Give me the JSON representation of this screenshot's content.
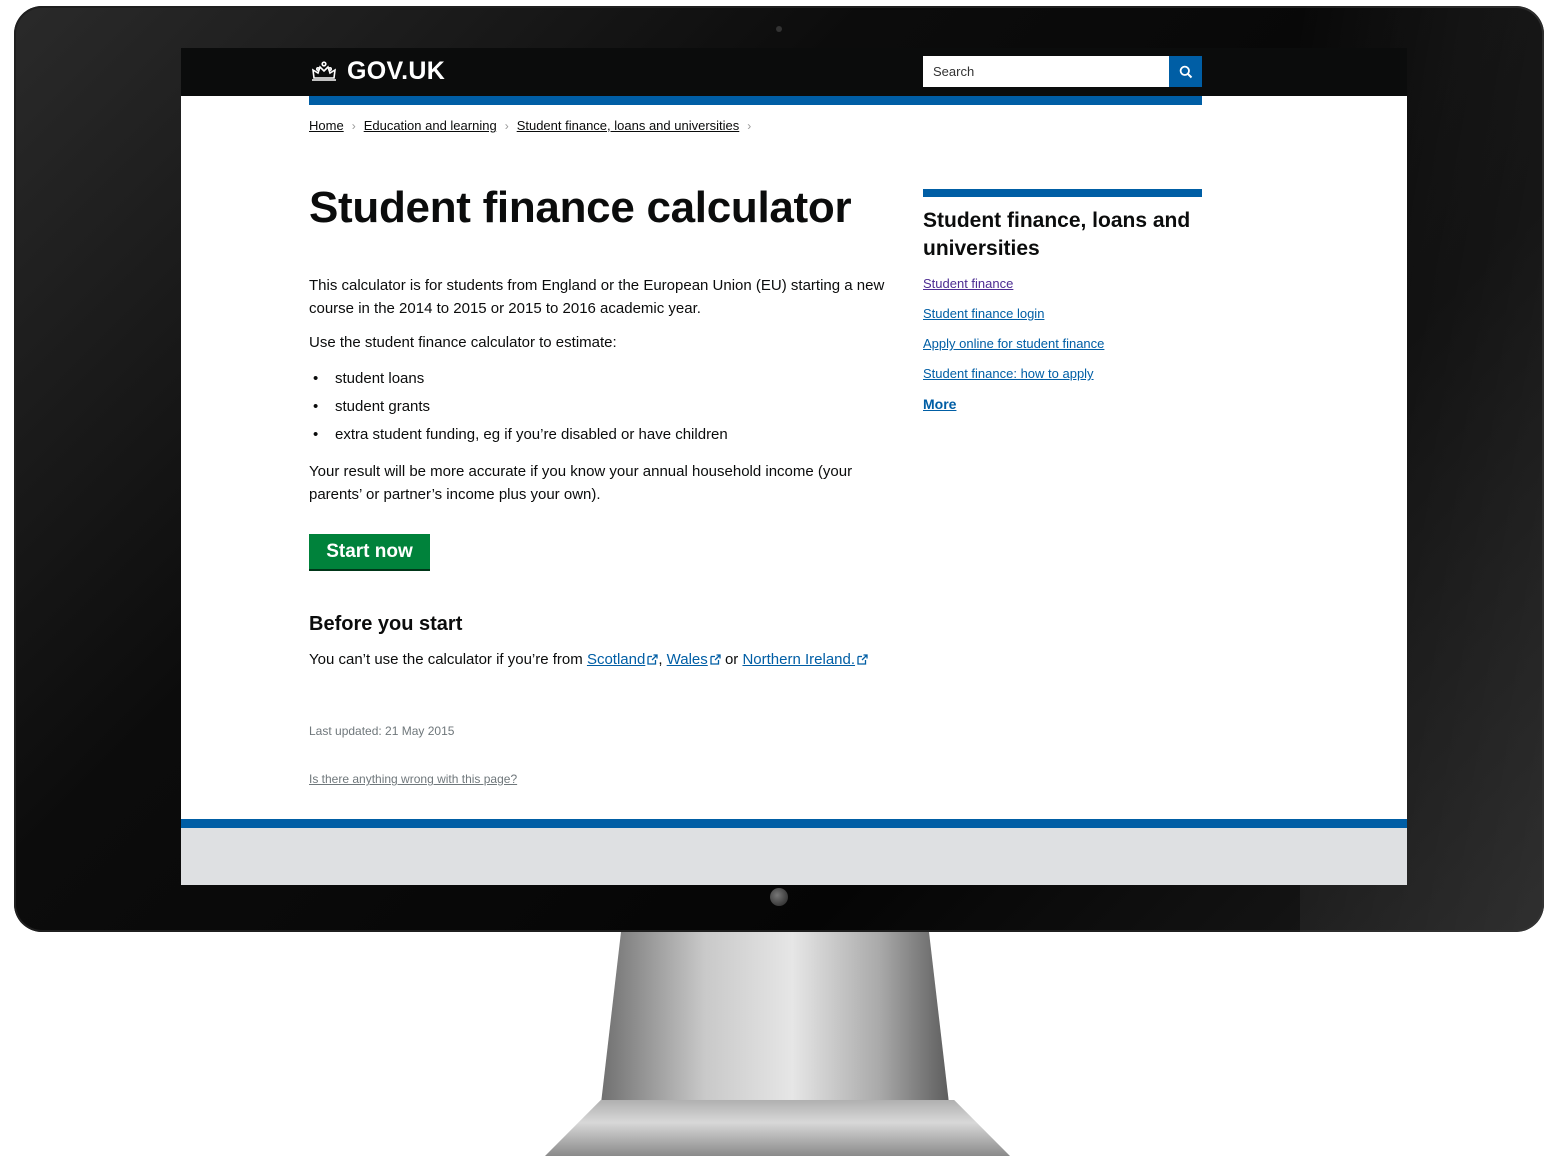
{
  "header": {
    "logo_text": "GOV.UK",
    "search_placeholder": "Search"
  },
  "breadcrumb": [
    "Home",
    "Education and learning",
    "Student finance, loans and universities"
  ],
  "main": {
    "title": "Student finance calculator",
    "intro": "This calculator is for students from England or the European Union (EU) starting a new course in the 2014 to 2015 or 2015 to 2016 academic year.",
    "estimate_lead": "Use the student finance calculator to estimate:",
    "bullets": [
      "student loans",
      "student grants",
      "extra student funding, eg if you’re disabled or have children"
    ],
    "income_note": "Your result will be more accurate if you know your annual household income (your parents’ or partner’s income plus your own).",
    "start_button": "Start now",
    "before_heading": "Before you start",
    "before_text_prefix": "You can’t use the calculator if you’re from ",
    "link_scotland": "Scotland",
    "sep_comma": ", ",
    "link_wales": "Wales",
    "sep_or": " or ",
    "link_ni": "Northern Ireland.",
    "last_updated": "Last updated: 21 May 2015",
    "report_link": "Is there anything wrong with this page?"
  },
  "sidebar": {
    "heading": "Student finance, loans and universities",
    "links": [
      "Student finance",
      "Student finance login",
      "Apply online for student finance",
      "Student finance: how to apply"
    ],
    "more": "More"
  },
  "colors": {
    "header_black": "#0b0c0c",
    "govuk_blue": "#005ea5",
    "start_green": "#00823b",
    "visited_purple": "#4c2c92",
    "footer_grey": "#dee0e2"
  }
}
